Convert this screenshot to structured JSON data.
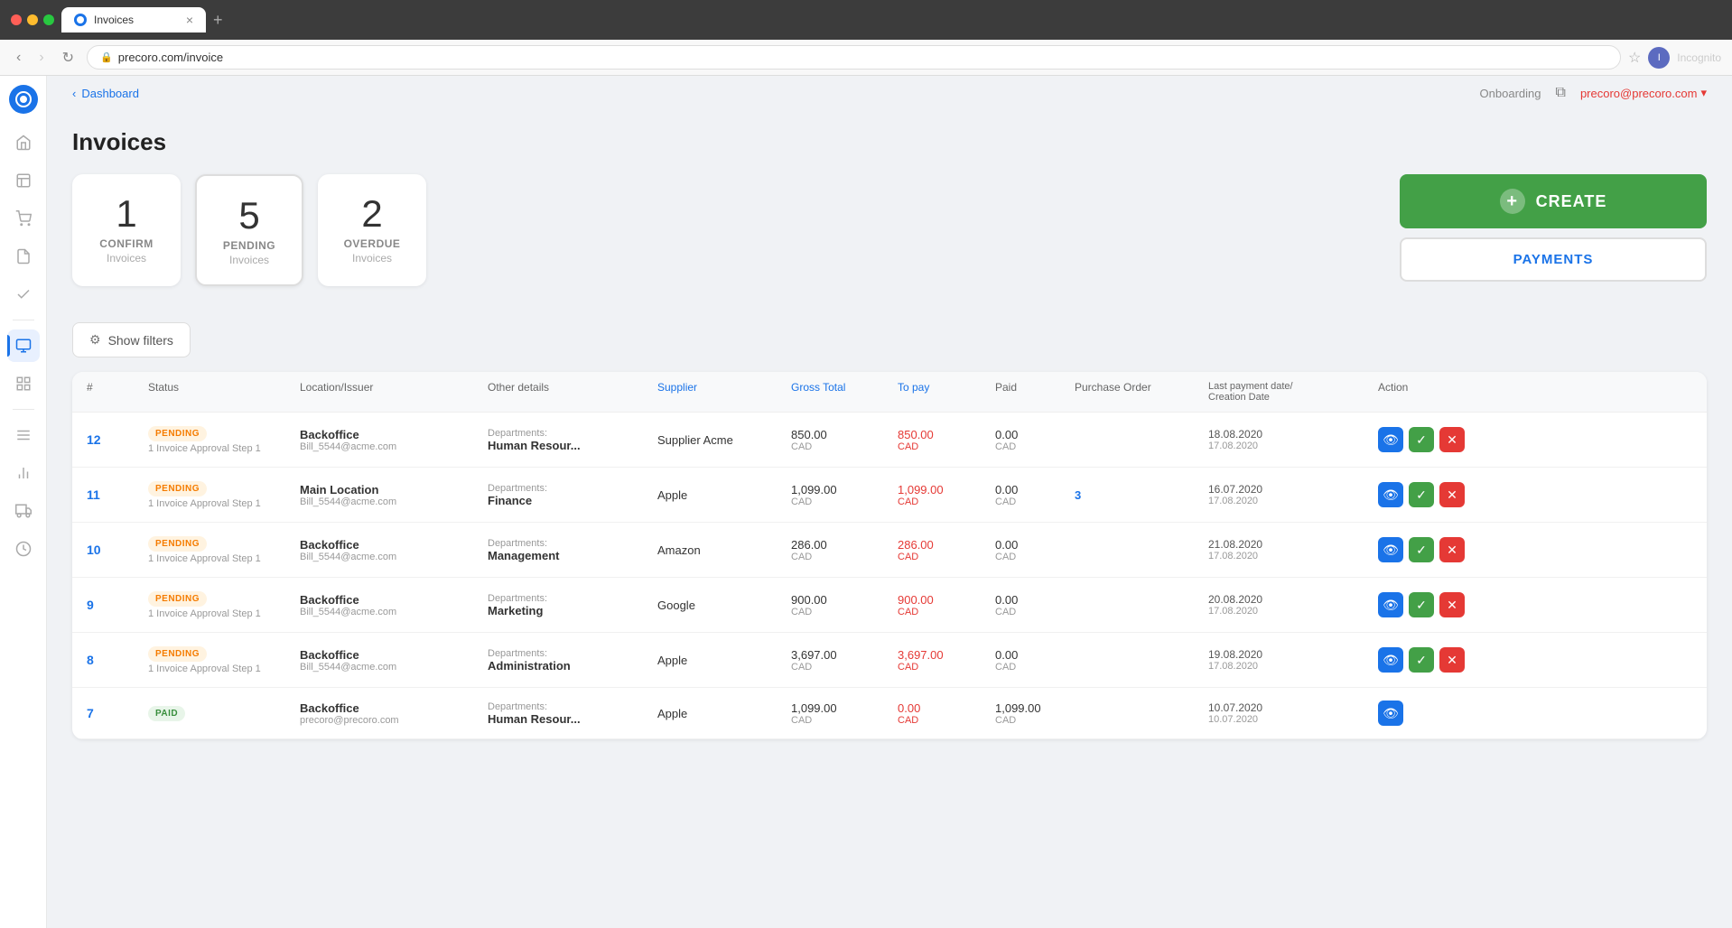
{
  "browser": {
    "tab_title": "Invoices",
    "url": "precoro.com/invoice",
    "user_label": "Incognito"
  },
  "topbar": {
    "breadcrumb_link": "Dashboard",
    "onboarding": "Onboarding",
    "user_email": "precoro@precoro.com"
  },
  "page": {
    "title": "Invoices"
  },
  "summary_cards": [
    {
      "number": "1",
      "status": "CONFIRM",
      "label": "Invoices"
    },
    {
      "number": "5",
      "status": "PENDING",
      "label": "Invoices"
    },
    {
      "number": "2",
      "status": "OVERDUE",
      "label": "Invoices"
    }
  ],
  "buttons": {
    "create": "CREATE",
    "payments": "PAYMENTS",
    "show_filters": "Show filters"
  },
  "table": {
    "columns": [
      "#",
      "Status",
      "Location/Issuer",
      "Other details",
      "Supplier",
      "Gross Total",
      "To pay",
      "Paid",
      "Purchase Order",
      "Last payment date/ Creation Date",
      "Action"
    ],
    "rows": [
      {
        "num": "12",
        "status": "PENDING",
        "status_type": "pending",
        "approval": "1 Invoice Approval Step 1",
        "location": "Backoffice",
        "email": "Bill_5544@acme.com",
        "dept_label": "Departments:",
        "dept_value": "Human Resour...",
        "supplier": "Supplier Acme",
        "gross_total": "850.00",
        "gross_currency": "CAD",
        "to_pay": "850.00",
        "to_pay_currency": "CAD",
        "to_pay_red": true,
        "paid": "0.00",
        "paid_currency": "CAD",
        "po": "",
        "last_payment": "18.08.2020",
        "creation": "17.08.2020",
        "has_view": true,
        "has_approve": true,
        "has_reject": true
      },
      {
        "num": "11",
        "status": "PENDING",
        "status_type": "pending",
        "approval": "1 Invoice Approval Step 1",
        "location": "Main Location",
        "email": "Bill_5544@acme.com",
        "dept_label": "Departments:",
        "dept_value": "Finance",
        "supplier": "Apple",
        "gross_total": "1,099.00",
        "gross_currency": "CAD",
        "to_pay": "1,099.00",
        "to_pay_currency": "CAD",
        "to_pay_red": true,
        "paid": "0.00",
        "paid_currency": "CAD",
        "po": "3",
        "last_payment": "16.07.2020",
        "creation": "17.08.2020",
        "has_view": true,
        "has_approve": true,
        "has_reject": true
      },
      {
        "num": "10",
        "status": "PENDING",
        "status_type": "pending",
        "approval": "1 Invoice Approval Step 1",
        "location": "Backoffice",
        "email": "Bill_5544@acme.com",
        "dept_label": "Departments:",
        "dept_value": "Management",
        "supplier": "Amazon",
        "gross_total": "286.00",
        "gross_currency": "CAD",
        "to_pay": "286.00",
        "to_pay_currency": "CAD",
        "to_pay_red": true,
        "paid": "0.00",
        "paid_currency": "CAD",
        "po": "",
        "last_payment": "21.08.2020",
        "creation": "17.08.2020",
        "has_view": true,
        "has_approve": true,
        "has_reject": true
      },
      {
        "num": "9",
        "status": "PENDING",
        "status_type": "pending",
        "approval": "1 Invoice Approval Step 1",
        "location": "Backoffice",
        "email": "Bill_5544@acme.com",
        "dept_label": "Departments:",
        "dept_value": "Marketing",
        "supplier": "Google",
        "gross_total": "900.00",
        "gross_currency": "CAD",
        "to_pay": "900.00",
        "to_pay_currency": "CAD",
        "to_pay_red": true,
        "paid": "0.00",
        "paid_currency": "CAD",
        "po": "",
        "last_payment": "20.08.2020",
        "creation": "17.08.2020",
        "has_view": true,
        "has_approve": true,
        "has_reject": true
      },
      {
        "num": "8",
        "status": "PENDING",
        "status_type": "pending",
        "approval": "1 Invoice Approval Step 1",
        "location": "Backoffice",
        "email": "Bill_5544@acme.com",
        "dept_label": "Departments:",
        "dept_value": "Administration",
        "supplier": "Apple",
        "gross_total": "3,697.00",
        "gross_currency": "CAD",
        "to_pay": "3,697.00",
        "to_pay_currency": "CAD",
        "to_pay_red": true,
        "paid": "0.00",
        "paid_currency": "CAD",
        "po": "",
        "last_payment": "19.08.2020",
        "creation": "17.08.2020",
        "has_view": true,
        "has_approve": true,
        "has_reject": true
      },
      {
        "num": "7",
        "status": "PAID",
        "status_type": "paid",
        "approval": "",
        "location": "Backoffice",
        "email": "precoro@precoro.com",
        "dept_label": "Departments:",
        "dept_value": "Human Resour...",
        "supplier": "Apple",
        "gross_total": "1,099.00",
        "gross_currency": "CAD",
        "to_pay": "0.00",
        "to_pay_currency": "CAD",
        "to_pay_red": true,
        "paid": "1,099.00",
        "paid_currency": "CAD",
        "po": "",
        "last_payment": "10.07.2020",
        "creation": "10.07.2020",
        "has_view": true,
        "has_approve": false,
        "has_reject": false
      }
    ]
  },
  "sidebar": {
    "items": [
      {
        "icon": "🏠",
        "label": "home",
        "active": false
      },
      {
        "icon": "📋",
        "label": "orders",
        "active": false
      },
      {
        "icon": "🛒",
        "label": "purchase",
        "active": false
      },
      {
        "icon": "📄",
        "label": "documents",
        "active": false
      },
      {
        "icon": "✅",
        "label": "approvals",
        "active": false
      },
      {
        "icon": "📊",
        "label": "invoices",
        "active": true
      },
      {
        "icon": "📁",
        "label": "catalog",
        "active": false
      },
      {
        "icon": "≡",
        "label": "menu",
        "active": false
      },
      {
        "icon": "📈",
        "label": "reports",
        "active": false
      },
      {
        "icon": "🚚",
        "label": "receiving",
        "active": false
      },
      {
        "icon": "🏷️",
        "label": "expenses",
        "active": false
      }
    ]
  }
}
